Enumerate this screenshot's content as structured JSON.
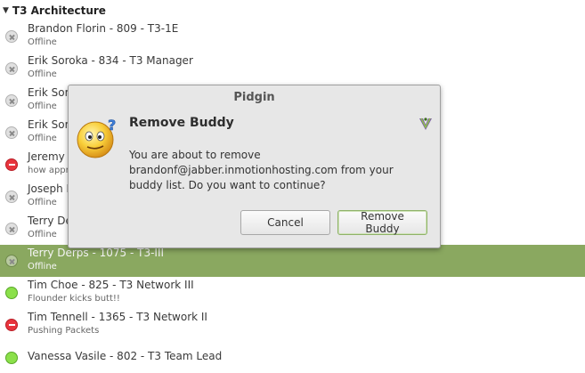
{
  "group": {
    "title": "T3 Architecture"
  },
  "buddies": [
    {
      "name": "Brandon Florin - 809 - T3-1E",
      "status_text": "Offline",
      "status": "offline"
    },
    {
      "name": "Erik Soroka - 834 - T3 Manager",
      "status_text": "Offline",
      "status": "offline"
    },
    {
      "name": "Erik Sor",
      "status_text": "Offline",
      "status": "offline"
    },
    {
      "name": "Erik Sor",
      "status_text": "Offline",
      "status": "offline"
    },
    {
      "name": "Jeremy I",
      "status_text": "how appr",
      "status": "busy"
    },
    {
      "name": "Joseph M",
      "status_text": "Offline",
      "status": "offline"
    },
    {
      "name": "Terry De",
      "status_text": "Offline",
      "status": "offline"
    },
    {
      "name": "Terry Derps - 1075 - T3-III",
      "status_text": "Offline",
      "status": "offline",
      "selected": true
    },
    {
      "name": "Tim Choe - 825 - T3 Network III",
      "status_text": "Flounder kicks butt!!",
      "status": "available"
    },
    {
      "name": "Tim Tennell - 1365 - T3 Network II",
      "status_text": "Pushing Packets",
      "status": "busy"
    },
    {
      "name": "Vanessa Vasile - 802 - T3 Team Lead",
      "status_text": "",
      "status": "available"
    }
  ],
  "dialog": {
    "window_title": "Pidgin",
    "heading": "Remove Buddy",
    "message": "You are about to remove brandonf@jabber.inmotionhosting.com from your buddy list.  Do you want to continue?",
    "cancel_label": "Cancel",
    "confirm_label": "Remove Buddy",
    "icon": "confused-smiley-icon",
    "plugin_icon": "pidgin-icon"
  },
  "colors": {
    "selection": "#8aa860",
    "available": "#8be04a",
    "busy": "#e8343d",
    "confirm_border": "#8fb369"
  }
}
